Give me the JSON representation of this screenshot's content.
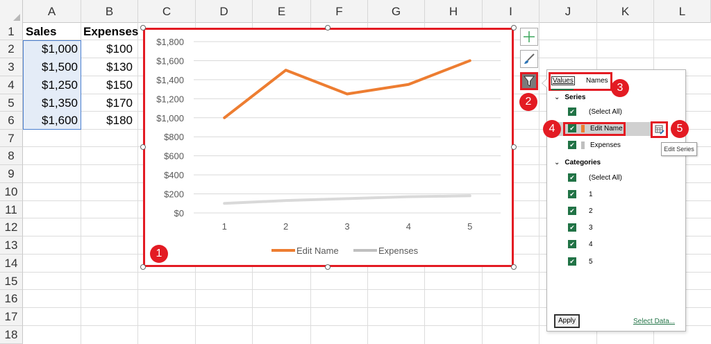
{
  "columns": [
    "A",
    "B",
    "C",
    "D",
    "E",
    "F",
    "G",
    "H",
    "I",
    "J",
    "K",
    "L"
  ],
  "rows": [
    "1",
    "2",
    "3",
    "4",
    "5",
    "6",
    "7",
    "8",
    "9",
    "10",
    "11",
    "12",
    "13",
    "14",
    "15",
    "16",
    "17",
    "18"
  ],
  "sheet": {
    "headers": [
      "Sales",
      "Expenses"
    ],
    "sales": [
      "$1,000",
      "$1,500",
      "$1,250",
      "$1,350",
      "$1,600"
    ],
    "expenses": [
      "$100",
      "$130",
      "$150",
      "$170",
      "$180"
    ]
  },
  "chart_data": {
    "type": "line",
    "x": [
      "1",
      "2",
      "3",
      "4",
      "5"
    ],
    "series": [
      {
        "name": "Edit Name",
        "values": [
          1000,
          1500,
          1250,
          1350,
          1600
        ],
        "color": "#ed7d31"
      },
      {
        "name": "Expenses",
        "values": [
          100,
          130,
          150,
          170,
          180
        ],
        "color": "#d9d9d9"
      }
    ],
    "y_ticks": [
      "$0",
      "$200",
      "$400",
      "$600",
      "$800",
      "$1,000",
      "$1,200",
      "$1,400",
      "$1,600",
      "$1,800"
    ],
    "ylim": [
      0,
      1800
    ],
    "grid": true,
    "legend": "bottom"
  },
  "badges": [
    "1",
    "2",
    "3",
    "4",
    "5"
  ],
  "filter_panel": {
    "tab_values": "Values",
    "tab_names": "Names",
    "series_heading": "Series",
    "series_items": [
      "(Select All)",
      "Edit Name",
      "Expenses"
    ],
    "categories_heading": "Categories",
    "category_items": [
      "(Select All)",
      "1",
      "2",
      "3",
      "4",
      "5"
    ],
    "apply": "Apply",
    "select_data": "Select Data...",
    "tooltip": "Edit Series"
  },
  "colors": {
    "accent": "#217346",
    "highlight": "#e31b23",
    "sales": "#ed7d31",
    "expenses": "#d9d9d9"
  }
}
